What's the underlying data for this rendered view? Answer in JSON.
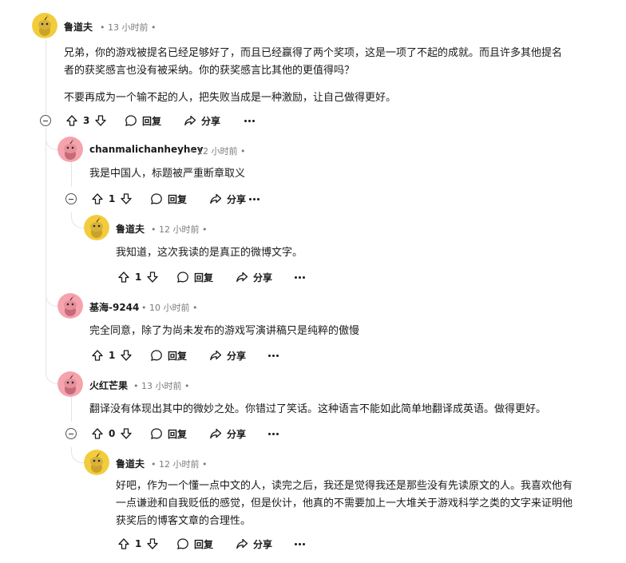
{
  "labels": {
    "reply": "回复",
    "share": "分享",
    "dot": "•"
  },
  "colors": {
    "avatar_yellow": "#f2cc3c",
    "avatar_pink": "#f5a3ad",
    "thread_line": "#e2e4e6",
    "meta_gray": "#7c7c7c"
  },
  "comments": [
    {
      "author": "鲁道夫",
      "time": "13 小时前",
      "avatar": "yellow",
      "paragraphs": [
        "兄弟，你的游戏被提名已经足够好了，而且已经赢得了两个奖项，这是一项了不起的成就。而且许多其他提名",
        "者的获奖感言也没有被采纳。你的获奖感言比其他的更值得吗？",
        "不要再成为一个输不起的人，把失败当成是一种激励，让自己做得更好。"
      ],
      "votes": "3"
    },
    {
      "author": "chanmalichanheyhey",
      "time": "12 小时前",
      "avatar": "pink",
      "paragraphs": [
        "我是中国人，标题被严重断章取义"
      ],
      "votes": "1"
    },
    {
      "author": "鲁道夫",
      "time": "12 小时前",
      "avatar": "yellow",
      "paragraphs": [
        "我知道，这次我读的是真正的微博文字。"
      ],
      "votes": "1"
    },
    {
      "author": "基海-9244",
      "time": "10 小时前",
      "avatar": "pink",
      "paragraphs": [
        "完全同意，除了为尚未发布的游戏写演讲稿只是纯粹的傲慢"
      ],
      "votes": "1"
    },
    {
      "author": "火红芒果",
      "time": "13 小时前",
      "avatar": "pink",
      "paragraphs": [
        "翻译没有体现出其中的微妙之处。你错过了笑话。这种语言不能如此简单地翻译成英语。做得更好。"
      ],
      "votes": "0"
    },
    {
      "author": "鲁道夫",
      "time": "12 小时前",
      "avatar": "yellow",
      "paragraphs": [
        "好吧，作为一个懂一点中文的人，读完之后，我还是觉得我还是那些没有先读原文的人。我喜欢他有",
        "一点谦逊和自我贬低的感觉，但是伙计，他真的不需要加上一大堆关于游戏科学之类的文字来证明他",
        "获奖后的博客文章的合理性。"
      ],
      "votes": "1"
    }
  ]
}
